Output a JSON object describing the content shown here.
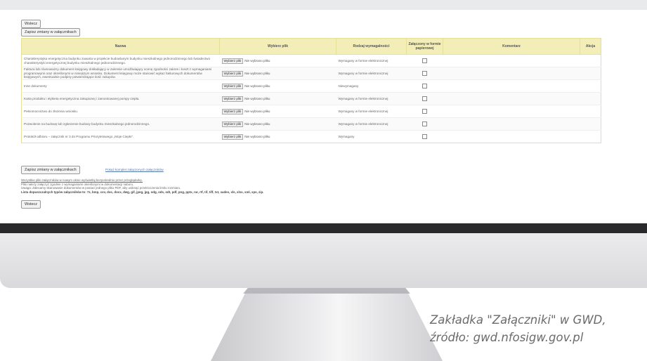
{
  "app": {
    "back_label": "Wstecz",
    "save_label": "Zapisz zmiany w załącznikach",
    "table": {
      "headers": {
        "name": "Nazwa",
        "file": "Wybierz plik",
        "type": "Rodzaj wymagalności",
        "paper": "Załączony w formie papierowej",
        "comment": "Komentarz",
        "action": "Akcja"
      },
      "rows": [
        {
          "name": "Charakterystyka energetyczna budynku zawarta w projekcie budowlanym budynku mieszkalnego jednorodzinnego lub świadectwo charakterystyki energetycznej budynku mieszkalnego jednorodzinnego.",
          "file_button": "Wybierz plik",
          "file_status": "Nie wybrano pliku",
          "type": "Wymagany w formie elektronicznej"
        },
        {
          "name": "Faktura lub równoważny dokument księgowy dokładający w zakresie umożliwiający ocenę zgodności zakres i koszt z wymaganiami programowymi oraz określonymi w niniejszym wniosku. Dokument księgowy może stanowić wykaz fakturowych dokumentów księgowych, ewentualnie podpisy potwierdzające ilość zakupów.",
          "file_button": "Wybierz plik",
          "file_status": "Nie wybrano pliku",
          "type": "Wymagany w formie elektronicznej"
        },
        {
          "name": "Inne dokumenty",
          "file_button": "Wybierz plik",
          "file_status": "Nie wybrano pliku",
          "type": "Niewymagany"
        },
        {
          "name": "Karta produktu i etykieta energetyczna zakupionej i zamontowanej pompy ciepła.",
          "file_button": "Wybierz plik",
          "file_status": "Nie wybrano pliku",
          "type": "Wymagany w formie elektronicznej"
        },
        {
          "name": "Pełnomocnictwo do złożenia wniosku.",
          "file_button": "Wybierz plik",
          "file_status": "Nie wybrano pliku",
          "type": "Wymagany w formie elektronicznej"
        },
        {
          "name": "Pozwolenie na budowę lub zgłoszenie budowy budynku mieszkalnego jednorodzinnego.",
          "file_button": "Wybierz plik",
          "file_status": "Nie wybrano pliku",
          "type": "Wymagany w formie elektronicznej"
        },
        {
          "name": "Protokół odbioru – załącznik nr 3 do Programu Priorytetowego „Moje Ciepło”.",
          "file_button": "Wybierz plik",
          "file_status": "Nie wybrano pliku",
          "type": "Wymagany"
        }
      ]
    },
    "show_all_link": "Pokaż komplet załączonych załączników",
    "notes": {
      "line1": "Wszystkie pliki załączników w nowym oknie wyświetlaj bezpośrednio przez przeglądarkę.",
      "line2": "Pliki należy załączyć zgodnie z wymaganiami określonymi w dokumentacji naboru.",
      "line3": "Uwaga: Zalecamy skanowanie dokumentów w postaci jednego pliku PDF, aby uniknąć przekroczenia limitu rozmiaru.",
      "line4": "Lista dopuszczalnych typów załączników to: 7z, bmp, csv, doc, docx, dwg, gif, jpeg, jpg, odg, ods, odt, pdf, png, pptx, rar, rtf, tif, tiff, txt, xades, xls, xlsx, xml, xps, zip."
    }
  },
  "caption": {
    "line1": "Zakładka \"Załączniki\" w GWD,",
    "line2": "źródło: gwd.nfosigw.gov.pl"
  }
}
